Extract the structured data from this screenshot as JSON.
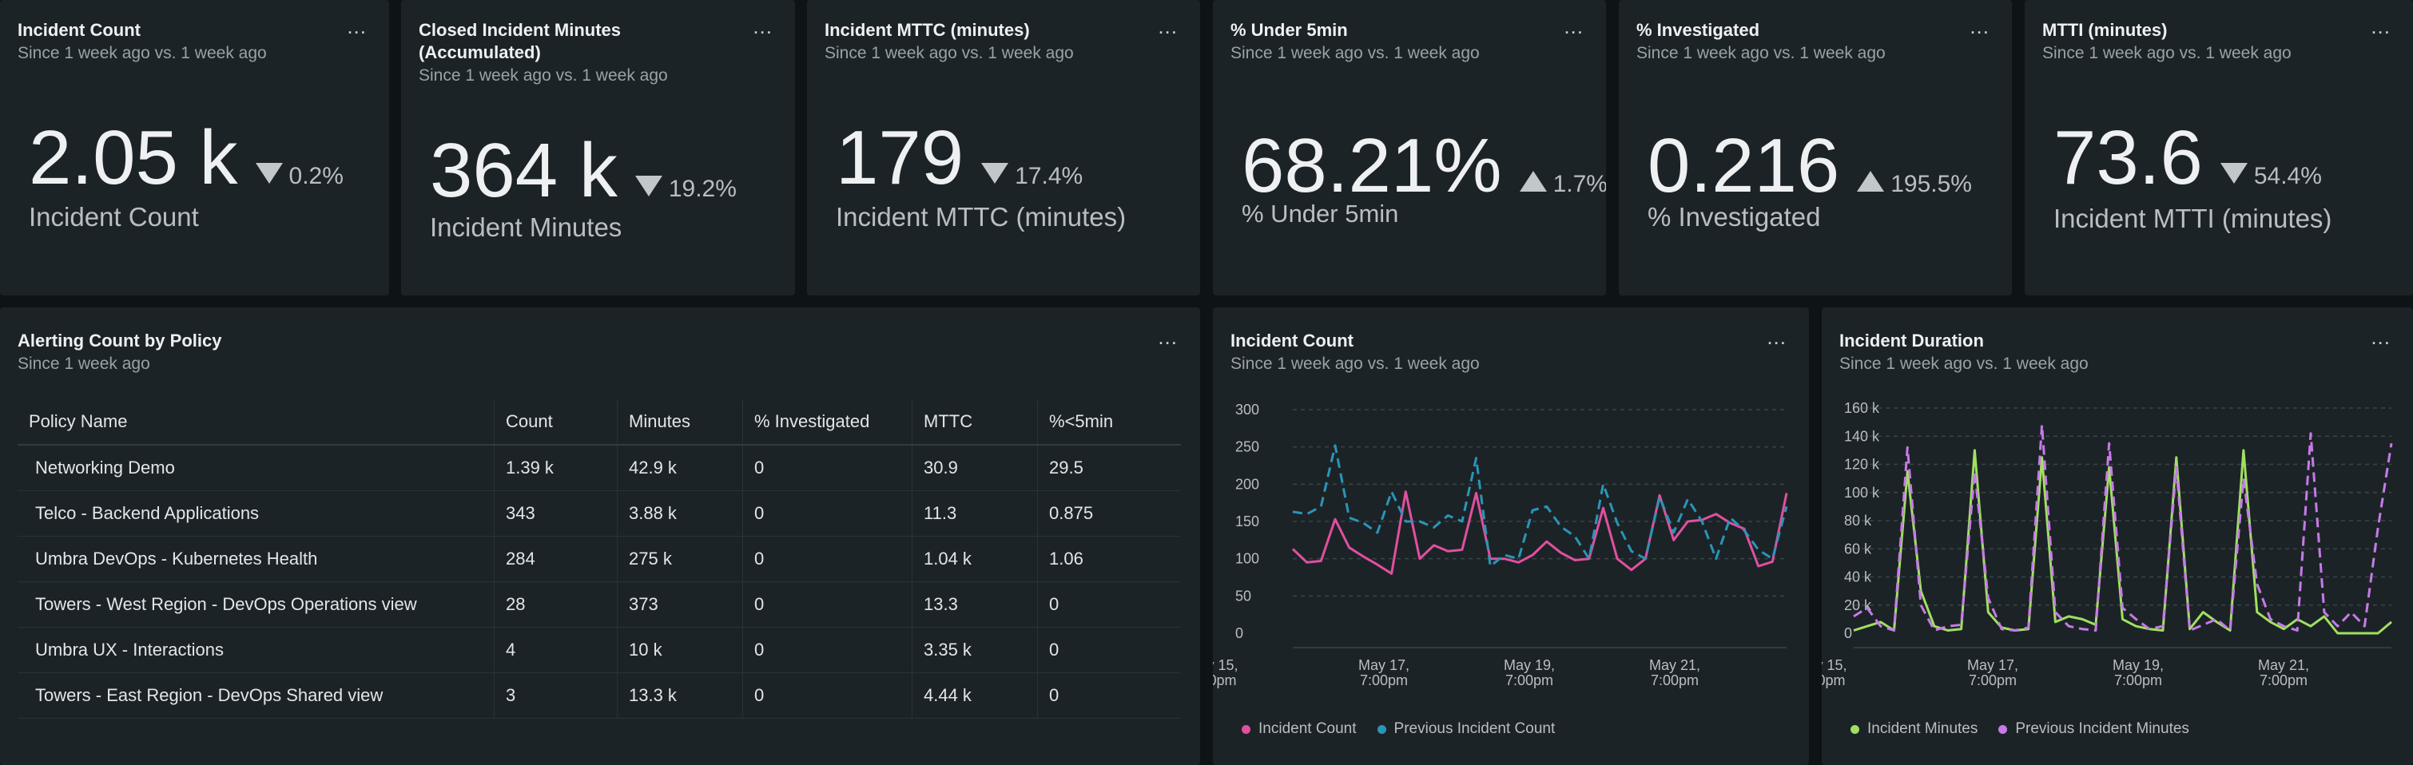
{
  "kpis": [
    {
      "title": "Incident Count",
      "subtitle": "Since 1 week ago vs. 1 week ago",
      "value": "2.05 k",
      "direction": "down",
      "change": "0.2%",
      "label": "Incident Count"
    },
    {
      "title": "Closed Incident Minutes (Accumulated)",
      "subtitle": "Since 1 week ago vs. 1 week ago",
      "value": "364 k",
      "direction": "down",
      "change": "19.2%",
      "label": "Incident Minutes"
    },
    {
      "title": "Incident MTTC (minutes)",
      "subtitle": "Since 1 week ago vs. 1 week ago",
      "value": "179",
      "direction": "down",
      "change": "17.4%",
      "label": "Incident MTTC (minutes)"
    },
    {
      "title": "% Under 5min",
      "subtitle": "Since 1 week ago vs. 1 week ago",
      "value": "68.21%",
      "direction": "up",
      "change": "1.7%",
      "label": "% Under 5min"
    },
    {
      "title": "% Investigated",
      "subtitle": "Since 1 week ago vs. 1 week ago",
      "value": "0.216",
      "direction": "up",
      "change": "195.5%",
      "label": "% Investigated"
    },
    {
      "title": "MTTI (minutes)",
      "subtitle": "Since 1 week ago vs. 1 week ago",
      "value": "73.6",
      "direction": "down",
      "change": "54.4%",
      "label": "Incident MTTI (minutes)"
    }
  ],
  "more_label": "...",
  "policy_table": {
    "title": "Alerting Count by Policy",
    "subtitle": "Since 1 week ago",
    "columns": [
      "Policy Name",
      "Count",
      "Minutes",
      "% Investigated",
      "MTTC",
      "%<5min"
    ],
    "rows": [
      [
        "Networking Demo",
        "1.39 k",
        "42.9 k",
        "0",
        "30.9",
        "29.5"
      ],
      [
        "Telco - Backend Applications",
        "343",
        "3.88 k",
        "0",
        "11.3",
        "0.875"
      ],
      [
        "Umbra DevOps - Kubernetes Health",
        "284",
        "275 k",
        "0",
        "1.04 k",
        "1.06"
      ],
      [
        "Towers - West Region - DevOps Operations view",
        "28",
        "373",
        "0",
        "13.3",
        "0"
      ],
      [
        "Umbra UX - Interactions",
        "4",
        "10 k",
        "0",
        "3.35 k",
        "0"
      ],
      [
        "Towers - East Region - DevOps Shared view",
        "3",
        "13.3 k",
        "0",
        "4.44 k",
        "0"
      ]
    ]
  },
  "chart_data": [
    {
      "type": "line",
      "title": "Incident Count",
      "subtitle": "Since 1 week ago vs. 1 week ago",
      "yticks": [
        "300",
        "250",
        "200",
        "150",
        "100",
        "50",
        "0"
      ],
      "ylim": [
        0,
        300
      ],
      "xtick_labels": [
        [
          "y 15,",
          "0pm"
        ],
        [
          "May 17,",
          "7:00pm"
        ],
        [
          "May 19,",
          "7:00pm"
        ],
        [
          "May 21,",
          "7:00pm"
        ]
      ],
      "x": [
        0,
        1,
        2,
        3,
        4,
        5,
        6,
        7,
        8,
        9,
        10,
        11,
        12,
        13,
        14,
        15,
        16,
        17,
        18,
        19,
        20,
        21,
        22,
        23,
        24,
        25,
        26,
        27,
        28,
        29,
        30,
        31,
        32,
        33,
        34,
        35
      ],
      "series": [
        {
          "name": "Incident Count",
          "color": "#e0509f",
          "dashed": false,
          "values": [
            113,
            95,
            97,
            153,
            115,
            103,
            92,
            80,
            190,
            100,
            118,
            110,
            112,
            188,
            100,
            100,
            95,
            105,
            123,
            108,
            98,
            100,
            168,
            100,
            85,
            100,
            185,
            125,
            150,
            152,
            160,
            148,
            140,
            90,
            96,
            188
          ]
        },
        {
          "name": "Previous Incident Count",
          "color": "#2a95b8",
          "dashed": true,
          "values": [
            163,
            160,
            170,
            252,
            155,
            148,
            135,
            190,
            150,
            150,
            142,
            158,
            150,
            235,
            90,
            105,
            100,
            165,
            170,
            143,
            130,
            100,
            200,
            148,
            110,
            100,
            183,
            135,
            180,
            150,
            100,
            155,
            138,
            112,
            100,
            170
          ]
        }
      ],
      "legend": [
        "Incident Count",
        "Previous Incident Count"
      ]
    },
    {
      "type": "line",
      "title": "Incident Duration",
      "subtitle": "Since 1 week ago vs. 1 week ago",
      "yticks": [
        "160 k",
        "140 k",
        "120 k",
        "100 k",
        "80 k",
        "60 k",
        "40 k",
        "20 k",
        "0"
      ],
      "ylim": [
        0,
        160000
      ],
      "xtick_labels": [
        [
          "y 15,",
          "0pm"
        ],
        [
          "May 17,",
          "7:00pm"
        ],
        [
          "May 19,",
          "7:00pm"
        ],
        [
          "May 21,",
          "7:00pm"
        ]
      ],
      "x": [
        0,
        1,
        2,
        3,
        4,
        5,
        6,
        7,
        8,
        9,
        10,
        11,
        12,
        13,
        14,
        15,
        16,
        17,
        18,
        19,
        20,
        21,
        22,
        23,
        24,
        25,
        26,
        27,
        28,
        29,
        30,
        31,
        32,
        33,
        34,
        35,
        36,
        37,
        38,
        39,
        40
      ],
      "series": [
        {
          "name": "Incident Minutes",
          "color": "#a0e060",
          "dashed": false,
          "values": [
            2000,
            5000,
            8000,
            2000,
            115000,
            30000,
            5000,
            2000,
            3000,
            130000,
            15000,
            4000,
            2000,
            3000,
            125000,
            8000,
            12000,
            10000,
            6000,
            118000,
            10000,
            5000,
            3000,
            2000,
            125000,
            3000,
            15000,
            8000,
            2000,
            130000,
            15000,
            8000,
            3000,
            10000,
            5000,
            12000,
            0,
            0,
            0,
            0,
            8000
          ]
        },
        {
          "name": "Previous Incident Minutes",
          "color": "#c77ae8",
          "dashed": true,
          "values": [
            12000,
            18000,
            5000,
            2000,
            132000,
            20000,
            2000,
            5000,
            6000,
            115000,
            25000,
            3000,
            2000,
            4000,
            148000,
            15000,
            5000,
            3000,
            2000,
            135000,
            18000,
            10000,
            3000,
            5000,
            118000,
            2000,
            6000,
            10000,
            2000,
            110000,
            35000,
            10000,
            5000,
            2000,
            142000,
            15000,
            5000,
            15000,
            5000,
            75000,
            135000
          ]
        }
      ],
      "legend": [
        "Incident Minutes",
        "Previous Incident Minutes"
      ]
    }
  ]
}
